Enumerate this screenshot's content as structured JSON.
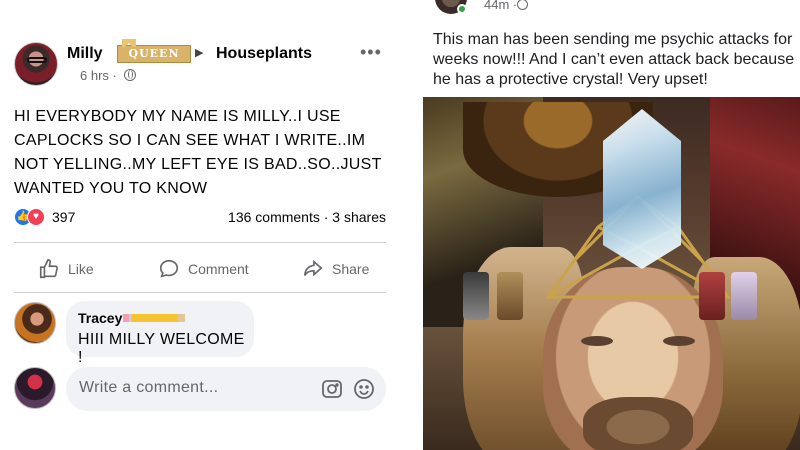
{
  "left_post": {
    "author": "Milly",
    "badge": "QUEEN",
    "group_arrow": "▶",
    "group": "Houseplants",
    "time": "6 hrs ·",
    "more": "•••",
    "body": "HI EVERYBODY MY NAME IS MILLY..I USE CAPLOCKS SO I CAN SEE WHAT I WRITE..IM NOT YELLING..MY LEFT EYE IS BAD..SO..JUST WANTED YOU TO KNOW",
    "reaction_count": "397",
    "comments_shares": "136 comments · 3 shares",
    "actions": {
      "like": "Like",
      "comment": "Comment",
      "share": "Share"
    },
    "comment": {
      "author": "Tracey",
      "text": "HIII MILLY WELCOME !"
    },
    "write_placeholder": "Write a comment..."
  },
  "right_post": {
    "time": "44m ·",
    "body": "This man has been sending me psychic attacks for weeks now!!! And I can’t even attack back because he has a protective crystal! Very upset!"
  },
  "colors": {
    "facebook_blue": "#1877f2",
    "love_red": "#f33e58",
    "secondary_text": "#65676b",
    "bubble_bg": "#f0f2f5",
    "online_green": "#31a24c"
  }
}
